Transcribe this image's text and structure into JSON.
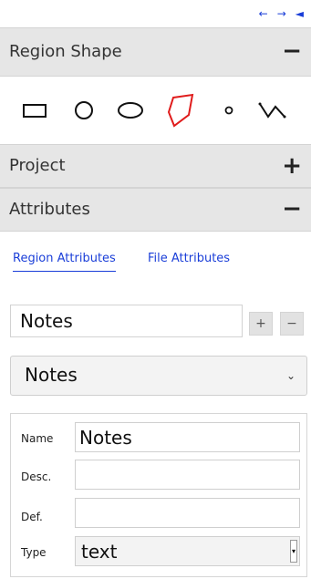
{
  "nav": {
    "left_arrow": "←",
    "right_arrow": "→",
    "collapse_arrow": "◄"
  },
  "region_shape": {
    "title": "Region Shape",
    "toggle": "−",
    "shapes": [
      {
        "name": "rectangle",
        "active": false
      },
      {
        "name": "circle",
        "active": false
      },
      {
        "name": "ellipse",
        "active": false
      },
      {
        "name": "polygon",
        "active": true
      },
      {
        "name": "point",
        "active": false
      },
      {
        "name": "polyline",
        "active": false
      }
    ],
    "active_color": "#e01b1b"
  },
  "project": {
    "title": "Project",
    "toggle": "+"
  },
  "attributes": {
    "title": "Attributes",
    "toggle": "−",
    "tabs": [
      "Region Attributes",
      "File Attributes"
    ],
    "active_tab": "Region Attributes",
    "new_attribute_value": "Notes",
    "add_label": "+",
    "remove_label": "−",
    "selected_attribute": "Notes",
    "details": {
      "name_label": "Name",
      "name_value": "Notes",
      "desc_label": "Desc.",
      "desc_value": "",
      "def_label": "Def.",
      "def_value": "",
      "type_label": "Type",
      "type_value": "text"
    }
  },
  "colors": {
    "link": "#1a3ed8",
    "section_bg": "#e6e6e6",
    "active_shape": "#e01b1b"
  }
}
